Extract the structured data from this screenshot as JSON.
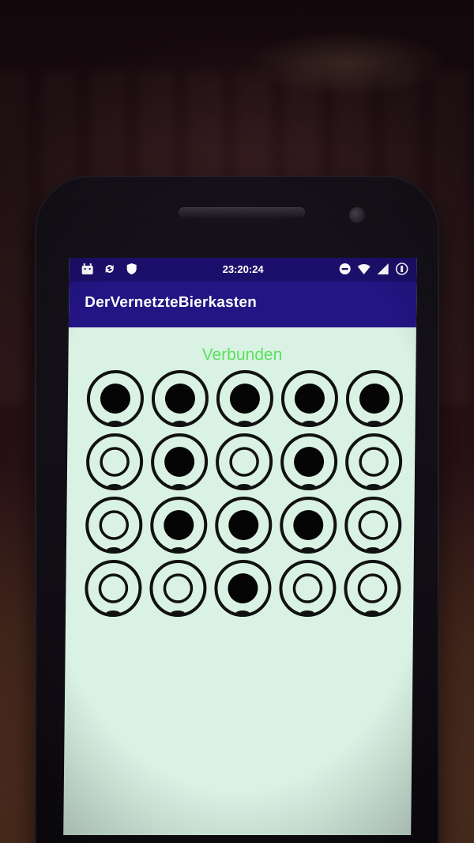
{
  "statusbar": {
    "time": "23:20:24",
    "left_icons": [
      "android-debug-icon",
      "sync-icon",
      "shield-icon"
    ],
    "right_icons": [
      "do-not-disturb-icon",
      "wifi-icon",
      "cell-signal-icon",
      "battery-icon"
    ]
  },
  "app": {
    "title": "DerVernetzteBierkasten"
  },
  "connection": {
    "status": "Verbunden",
    "color": "#5ce05c"
  },
  "crate": {
    "rows": 4,
    "columns": 5,
    "slots": [
      [
        true,
        true,
        true,
        true,
        true
      ],
      [
        false,
        true,
        false,
        true,
        false
      ],
      [
        false,
        true,
        true,
        true,
        false
      ],
      [
        false,
        false,
        true,
        false,
        false
      ]
    ],
    "filled_icon": "bottle-present-icon",
    "empty_icon": "bottle-empty-icon"
  },
  "colors": {
    "statusbar": "#1c0f6b",
    "appbar": "#241585",
    "screen_background": "#d9f2e4",
    "ring": "#111111"
  }
}
